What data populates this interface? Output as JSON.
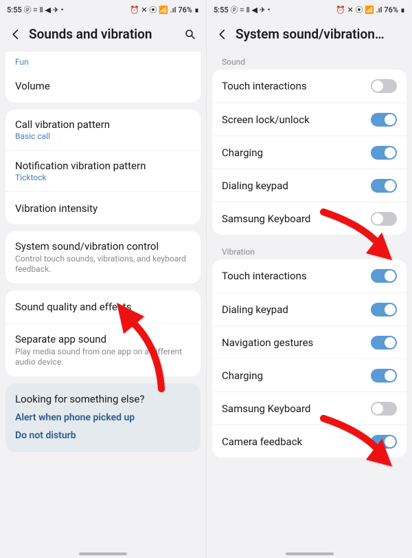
{
  "status": {
    "time": "5:55",
    "left_icons": "ⓟ ⌗ Ⅱ ◀ ✈ •",
    "right_icons": "⏰ ✕ ⦿ 📶 .ıl",
    "battery": "76%"
  },
  "left": {
    "title": "Sounds and vibration",
    "fun": "Fun",
    "volume": "Volume",
    "call_pat": {
      "label": "Call vibration pattern",
      "value": "Basic call"
    },
    "notif_pat": {
      "label": "Notification vibration pattern",
      "value": "Ticktock"
    },
    "vib_int": "Vibration intensity",
    "sys_ctrl": {
      "label": "System sound/vibration control",
      "desc": "Control touch sounds, vibrations, and keyboard feedback."
    },
    "quality": "Sound quality and effects",
    "separate": {
      "label": "Separate app sound",
      "desc": "Play media sound from one app on a different audio device."
    },
    "footer": {
      "title": "Looking for something else?",
      "link1": "Alert when phone picked up",
      "link2": "Do not disturb"
    }
  },
  "right": {
    "title": "System sound/vibration…",
    "section_sound": "Sound",
    "section_vib": "Vibration",
    "sound": {
      "touch": "Touch interactions",
      "lock": "Screen lock/unlock",
      "charging": "Charging",
      "dial": "Dialing keypad",
      "kbd": "Samsung Keyboard"
    },
    "vib": {
      "touch": "Touch interactions",
      "dial": "Dialing keypad",
      "nav": "Navigation gestures",
      "charging": "Charging",
      "kbd": "Samsung Keyboard",
      "camera": "Camera feedback"
    }
  }
}
